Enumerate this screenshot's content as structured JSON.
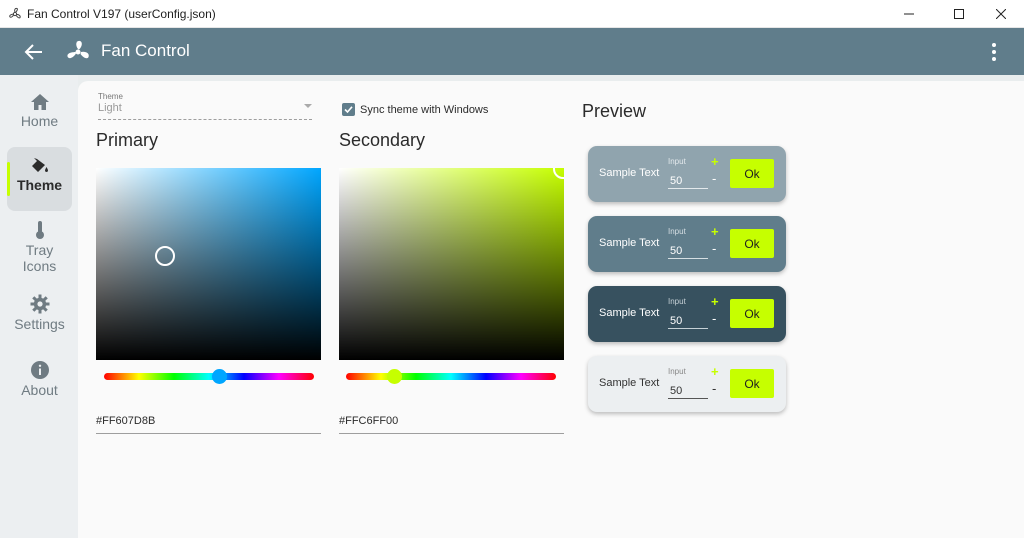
{
  "window": {
    "title": "Fan Control V197 (userConfig.json)"
  },
  "appbar": {
    "title": "Fan Control",
    "back_icon": "arrow-left-icon",
    "fan_icon": "fan-icon",
    "menu_icon": "more-vertical-icon",
    "color": "#607d8b"
  },
  "sidebar": {
    "items": [
      {
        "label": "Home",
        "icon": "home-icon"
      },
      {
        "label": "Theme",
        "icon": "paint-bucket-icon",
        "selected": true
      },
      {
        "label": "Tray Icons",
        "icon": "thermometer-icon"
      },
      {
        "label": "Settings",
        "icon": "gear-icon"
      },
      {
        "label": "About",
        "icon": "info-icon"
      }
    ]
  },
  "theme": {
    "select_label": "Theme",
    "select_value": "Light",
    "sync_label": "Sync theme with Windows",
    "sync_checked": true
  },
  "primary": {
    "heading": "Primary",
    "hex": "#FF607D8B",
    "color": "#607d8b"
  },
  "secondary": {
    "heading": "Secondary",
    "hex": "#FFC6FF00",
    "color": "#c6ff00"
  },
  "preview": {
    "heading": "Preview",
    "cards": [
      {
        "sample": "Sample Text",
        "input_label": "Input",
        "input_value": "50",
        "plus": "+",
        "minus": "-",
        "ok": "Ok",
        "bg": "#90a4ae"
      },
      {
        "sample": "Sample Text",
        "input_label": "Input",
        "input_value": "50",
        "plus": "+",
        "minus": "-",
        "ok": "Ok",
        "bg": "#607d8b"
      },
      {
        "sample": "Sample Text",
        "input_label": "Input",
        "input_value": "50",
        "plus": "+",
        "minus": "-",
        "ok": "Ok",
        "bg": "#37515f"
      },
      {
        "sample": "Sample Text",
        "input_label": "Input",
        "input_value": "50",
        "plus": "+",
        "minus": "-",
        "ok": "Ok",
        "bg": "#eceff1"
      }
    ]
  }
}
